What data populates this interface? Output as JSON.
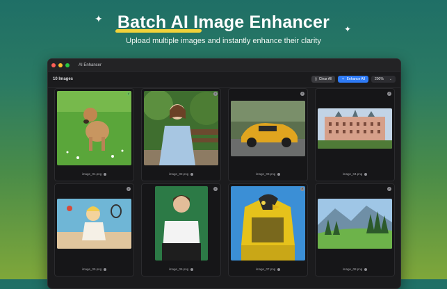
{
  "hero": {
    "title": "Batch AI Image Enhancer",
    "subtitle": "Upload multiple images and instantly enhance their clarity",
    "accent_color": "#f1d23a"
  },
  "window": {
    "title": "AI Enhancer",
    "count_label": "10 Images",
    "toolbar": {
      "clear_label": "Clear All",
      "enhance_label": "Enhance All",
      "zoom_value": "200%"
    }
  },
  "images": [
    {
      "filename": "image_01.png",
      "subject": "dog-running-in-grass"
    },
    {
      "filename": "image_02.png",
      "subject": "woman-on-park-bench"
    },
    {
      "filename": "image_03.png",
      "subject": "yellow-sports-car"
    },
    {
      "filename": "image_04.png",
      "subject": "grand-hotel-building"
    },
    {
      "filename": "image_05.png",
      "subject": "anime-tennis-player"
    },
    {
      "filename": "image_06.png",
      "subject": "young-man-portrait"
    },
    {
      "filename": "image_07.png",
      "subject": "robotic-eagle"
    },
    {
      "filename": "image_08.png",
      "subject": "mountain-meadow"
    }
  ]
}
